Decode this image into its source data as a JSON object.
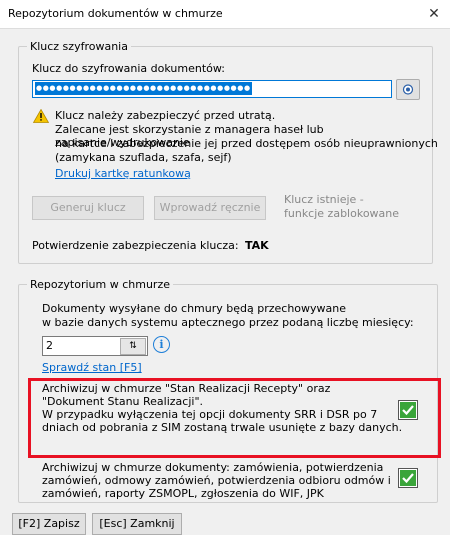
{
  "window": {
    "title": "Repozytorium dokumentów w chmurze",
    "close_label": "✕"
  },
  "encryption": {
    "legend": "Klucz szyfrowania",
    "field_label": "Klucz do szyfrowania dokumentów:",
    "key_value": "●●●●●●●●●●●●●●●●●●●●●●●●●●●●●●●●",
    "warning_line1": "Klucz należy zabezpieczyć przed utratą.",
    "warning_line2": "Zalecane jest skorzystanie z managera haseł lub zapisanie/wydrukowanie",
    "warning_line3": "na kartce i zabezpieczenie jej przed dostępem osób nieuprawnionych",
    "warning_line4": "(zamykana szuflada, szafa, sejf)",
    "print_link": "Drukuj kartkę ratunkową",
    "generate_button": "Generuj klucz",
    "manual_button": "Wprowadź ręcznie",
    "locked_note_line1": "Klucz istnieje -",
    "locked_note_line2": "funkcje zablokowane",
    "confirm_label": "Potwierdzenie zabezpieczenia klucza:",
    "confirm_value": "TAK"
  },
  "repository": {
    "legend": "Repozytorium w chmurze",
    "desc_line1": "Dokumenty wysyłane do chmury będą przechowywane",
    "desc_line2": "w bazie danych systemu aptecznego przez podaną liczbę miesięcy:",
    "months_value": "2",
    "check_status_link": "Sprawdź stan [F5]",
    "archive1_line1": "Archiwizuj w chmurze \"Stan Realizacji Recepty\" oraz",
    "archive1_line2": "\"Dokument Stanu Realizacji\".",
    "archive1_line3": "W przypadku wyłączenia tej opcji dokumenty SRR i DSR po 7",
    "archive1_line4": "dniach od pobrania z SIM zostaną trwale usunięte z bazy danych.",
    "archive1_checked": true,
    "archive2_line1": "Archiwizuj w chmurze dokumenty: zamówienia, potwierdzenia",
    "archive2_line2": "zamówień, odmowy zamówień, potwierdzenia odbioru odmów i",
    "archive2_line3": "zamówień, raporty ZSMOPL, zgłoszenia do WIF, JPK",
    "archive2_checked": true
  },
  "footer": {
    "save_button": "[F2] Zapisz",
    "close_button": "[Esc] Zamknij"
  },
  "colors": {
    "accent": "#0078d7",
    "highlight": "#e81123",
    "check": "#3aa53a",
    "link": "#0066cc"
  }
}
